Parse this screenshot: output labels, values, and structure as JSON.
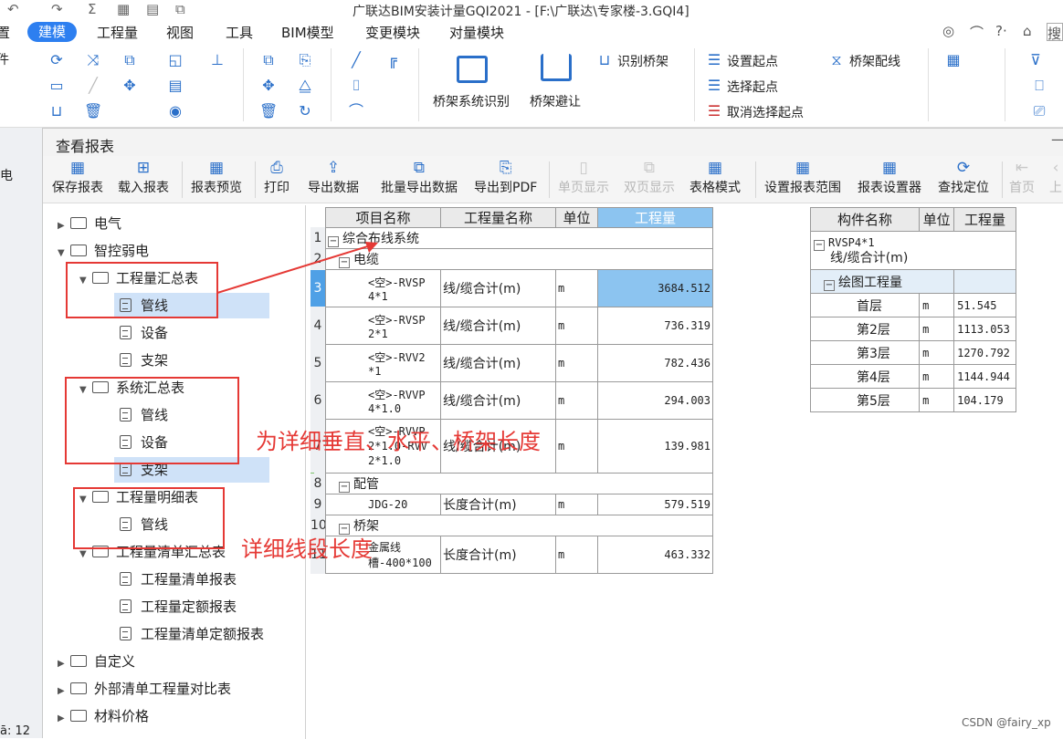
{
  "title": "广联达BIM安装计量GQI2021 - [F:\\广联达\\专家楼-3.GQI4]",
  "menu": [
    "置",
    "建模",
    "工程量",
    "视图",
    "工具",
    "BIM模型",
    "变更模块",
    "对量模块"
  ],
  "ribbon": {
    "bridge_identify": "桥架系统识别",
    "bridge_avoid": "桥架避让",
    "recognize_bridge": "识别桥架",
    "set_start": "设置起点",
    "select_start": "选择起点",
    "cancel_start": "取消选择起点",
    "bridge_wiring": "桥架配线"
  },
  "left_strip": {
    "text1": "件",
    "text2": "电",
    "bottom": "ā: 12"
  },
  "dialog": {
    "title": "查看报表",
    "toolbar": [
      {
        "label": "保存报表",
        "enabled": true
      },
      {
        "label": "载入报表",
        "enabled": true
      },
      {
        "label": "报表预览",
        "enabled": true
      },
      {
        "label": "打印",
        "enabled": true
      },
      {
        "label": "导出数据",
        "enabled": true
      },
      {
        "label": "批量导出数据",
        "enabled": true
      },
      {
        "label": "导出到PDF",
        "enabled": true
      },
      {
        "label": "单页显示",
        "enabled": false
      },
      {
        "label": "双页显示",
        "enabled": false
      },
      {
        "label": "表格模式",
        "enabled": true
      },
      {
        "label": "设置报表范围",
        "enabled": true
      },
      {
        "label": "报表设置器",
        "enabled": true
      },
      {
        "label": "查找定位",
        "enabled": true
      },
      {
        "label": "首页",
        "enabled": false
      },
      {
        "label": "上",
        "enabled": false
      }
    ]
  },
  "tree": [
    {
      "label": "电气",
      "level": 0,
      "type": "folder",
      "expanded": false
    },
    {
      "label": "智控弱电",
      "level": 0,
      "type": "folder",
      "expanded": true
    },
    {
      "label": "工程量汇总表",
      "level": 1,
      "type": "folder",
      "expanded": true
    },
    {
      "label": "管线",
      "level": 2,
      "type": "doc",
      "selected": true
    },
    {
      "label": "设备",
      "level": 2,
      "type": "doc"
    },
    {
      "label": "支架",
      "level": 2,
      "type": "doc"
    },
    {
      "label": "系统汇总表",
      "level": 1,
      "type": "folder",
      "expanded": true
    },
    {
      "label": "管线",
      "level": 2,
      "type": "doc"
    },
    {
      "label": "设备",
      "level": 2,
      "type": "doc"
    },
    {
      "label": "支架",
      "level": 2,
      "type": "doc",
      "selected": true
    },
    {
      "label": "工程量明细表",
      "level": 1,
      "type": "folder",
      "expanded": true
    },
    {
      "label": "管线",
      "level": 2,
      "type": "doc"
    },
    {
      "label": "工程量清单汇总表",
      "level": 1,
      "type": "folder",
      "expanded": true
    },
    {
      "label": "工程量清单报表",
      "level": 2,
      "type": "doc"
    },
    {
      "label": "工程量定额报表",
      "level": 2,
      "type": "doc"
    },
    {
      "label": "工程量清单定额报表",
      "level": 2,
      "type": "doc"
    },
    {
      "label": "自定义",
      "level": 0,
      "type": "folder",
      "expanded": false
    },
    {
      "label": "外部清单工程量对比表",
      "level": 0,
      "type": "folder",
      "expanded": false
    },
    {
      "label": "材料价格",
      "level": 0,
      "type": "folder",
      "expanded": false
    }
  ],
  "grid": {
    "headers": [
      "项目名称",
      "工程量名称",
      "单位",
      "工程量"
    ],
    "group_system": "综合布线系统",
    "group_cable": "电缆",
    "group_pipe": "配管",
    "group_bridge": "桥架",
    "rows": [
      {
        "n": "3",
        "name": "<空>-RVSP 4*1",
        "qty_name": "线/缆合计(m)",
        "unit": "m",
        "value": "3684.512"
      },
      {
        "n": "4",
        "name": "<空>-RVSP 2*1",
        "qty_name": "线/缆合计(m)",
        "unit": "m",
        "value": "736.319"
      },
      {
        "n": "5",
        "name": "<空>-RVV2 *1",
        "qty_name": "线/缆合计(m)",
        "unit": "m",
        "value": "782.436"
      },
      {
        "n": "6",
        "name": "<空>-RVVP 4*1.0",
        "qty_name": "线/缆合计(m)",
        "unit": "m",
        "value": "294.003"
      },
      {
        "n": "7",
        "name": "<空>-RVVP 2*1.0-RVV 2*1.0",
        "qty_name": "线/缆合计(m)",
        "unit": "m",
        "value": "139.981"
      },
      {
        "n": "9",
        "name": "JDG-20",
        "qty_name": "长度合计(m)",
        "unit": "m",
        "value": "579.519"
      },
      {
        "n": "11",
        "name": "金属线槽-400*100",
        "qty_name": "长度合计(m)",
        "unit": "m",
        "value": "463.332"
      }
    ]
  },
  "right_grid": {
    "headers": [
      "构件名称",
      "单位",
      "工程量"
    ],
    "component": "RVSP4*1",
    "component_sub": "线/缆合计(m)",
    "group": "绘图工程量",
    "rows": [
      {
        "floor": "首层",
        "unit": "m",
        "value": "51.545"
      },
      {
        "floor": "第2层",
        "unit": "m",
        "value": "1113.053"
      },
      {
        "floor": "第3层",
        "unit": "m",
        "value": "1270.792"
      },
      {
        "floor": "第4层",
        "unit": "m",
        "value": "1144.944"
      },
      {
        "floor": "第5层",
        "unit": "m",
        "value": "104.179"
      }
    ]
  },
  "annotations": {
    "note1": "为详细垂直、水平、桥架长度",
    "note2": "详细线段长度"
  },
  "watermark": "CSDN @fairy_xp",
  "colors": {
    "accent": "#2d7ff0",
    "annotation": "#e53935",
    "selection": "#8cc4f0"
  }
}
